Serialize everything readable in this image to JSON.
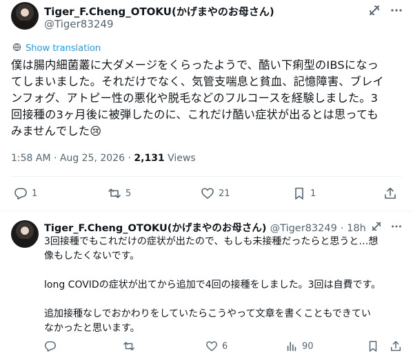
{
  "main_tweet": {
    "display_name": "Tiger_F.Cheng_OTOKU(かげまやのお母さん)",
    "handle": "@Tiger83249",
    "show_translation": "Show translation",
    "lines": [
      "僕は腸内細菌叢に大ダメージをくらったようで、酷い下痢型のIBSになっ",
      "てしまいました。それだけでなく、気管支喘息と貧血、記憶障害、ブレイ",
      "ンフォグ、アトピー性の悪化や脱毛などのフルコースを経験しました。3",
      "回接種の3ヶ月後に被弾したのに、これだけ酷い症状が出るとは思っても",
      "みませんでした"
    ],
    "emoji": "😢",
    "timestamp": "1:58 AM · Aug 25, 2026 · ",
    "views_count": "2,131",
    "views_label": " Views",
    "replies": "1",
    "reposts": "5",
    "likes": "21",
    "bookmarks": "1"
  },
  "reply_tweet": {
    "display_name": "Tiger_F.Cheng_OTOKU(かげまやのお母さん)",
    "handle": "@Tiger83249",
    "time": "· 18h",
    "lines": [
      "3回接種でもこれだけの症状が出たので、もしも未接種だったらと思うと…想",
      "像もしたくないです。",
      "",
      "long COVIDの症状が出てから追加で4回の接種をしました。3回は自費です。",
      "",
      "追加接種なしでおかわりをしていたらこうやって文章を書くこともできてい",
      "なかったと思います。"
    ],
    "replies": "",
    "reposts": "",
    "likes": "6",
    "views": "90"
  },
  "colors": {
    "muted": "#536471",
    "link": "#1d9bf0",
    "text": "#0f1419",
    "divider": "#eff3f4"
  },
  "icons": [
    "grok-slash-icon",
    "more-icon",
    "translate-icon",
    "reply-icon",
    "repost-icon",
    "like-icon",
    "bookmark-icon",
    "share-icon",
    "views-icon"
  ]
}
